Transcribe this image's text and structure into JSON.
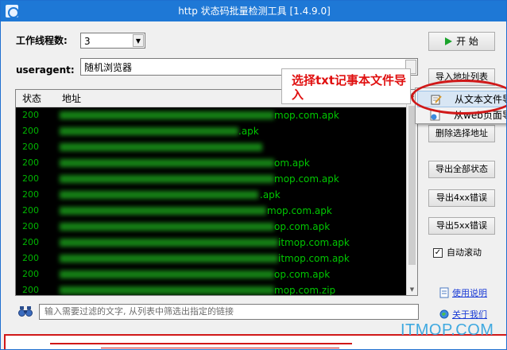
{
  "window": {
    "title": "http 状态码批量检测工具 [1.4.9.0]"
  },
  "threads": {
    "label": "工作线程数:",
    "value": "3"
  },
  "useragent": {
    "label": "useragent:",
    "value": "随机浏览器"
  },
  "buttons": {
    "start": "开 始",
    "import": "导入地址列表",
    "delete": "删除选择地址",
    "export_all": "导出全部状态",
    "export_4xx": "导出4xx错误",
    "export_5xx": "导出5xx错误"
  },
  "table": {
    "headers": [
      "状态",
      "地址"
    ],
    "rows": [
      {
        "status": "200",
        "url": "mop.com.apk"
      },
      {
        "status": "200",
        "url": ".apk"
      },
      {
        "status": "200",
        "url": ""
      },
      {
        "status": "200",
        "url": "om.apk"
      },
      {
        "status": "200",
        "url": "mop.com.apk"
      },
      {
        "status": "200",
        "url": ".apk"
      },
      {
        "status": "200",
        "url": "mop.com.apk"
      },
      {
        "status": "200",
        "url": "op.com.apk"
      },
      {
        "status": "200",
        "url": "itmop.com.apk"
      },
      {
        "status": "200",
        "url": "itmop.com.apk"
      },
      {
        "status": "200",
        "url": "op.com.apk"
      },
      {
        "status": "200",
        "url": "mop.com.zip"
      }
    ]
  },
  "context_menu": {
    "items": [
      "从文本文件导",
      "从web页面导"
    ]
  },
  "annotation": {
    "text": "选择txt记事本文件导入"
  },
  "filter": {
    "placeholder": "输入需要过滤的文字, 从列表中筛选出指定的链接"
  },
  "auto_scroll": {
    "label": "自动滚动",
    "checked": true
  },
  "links": {
    "help": "使用说明",
    "about": "关于我们"
  },
  "watermark": "ITMOP.COM"
}
